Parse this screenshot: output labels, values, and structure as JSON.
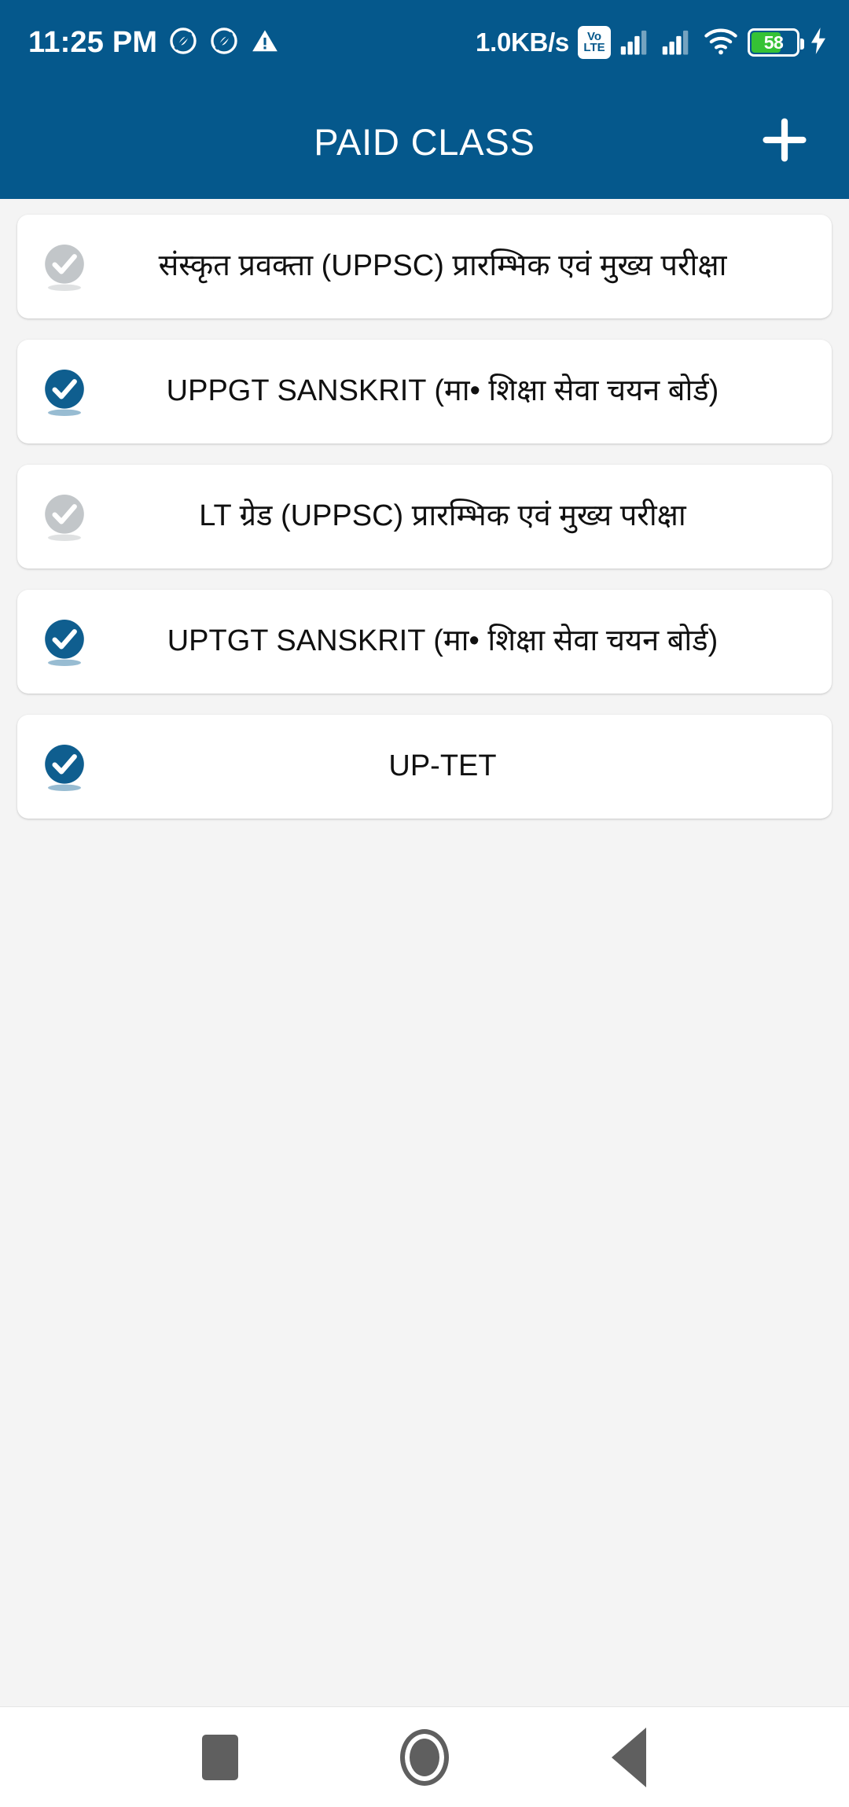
{
  "statusbar": {
    "clock": "11:25 PM",
    "network_speed": "1.0KB/s",
    "volte_top": "Vo",
    "volte_bottom": "LTE",
    "battery_percent": "58",
    "icons": [
      "dnd-icon",
      "dnd-icon",
      "warning-triangle-icon",
      "volte-icon",
      "signal-bars-icon",
      "signal-bars-icon",
      "wifi-icon",
      "battery-icon",
      "charging-bolt-icon"
    ]
  },
  "appbar": {
    "title": "PAID CLASS",
    "add_icon": "plus-icon"
  },
  "list": {
    "items": [
      {
        "label": "संस्कृत प्रवक्ता (UPPSC) प्रारम्भिक  एवं  मुख्य परीक्षा",
        "state": "inactive",
        "badge_icon": "check-circle-icon"
      },
      {
        "label": "UPPGT SANSKRIT (मा• शिक्षा सेवा चयन बोर्ड)",
        "state": "active",
        "badge_icon": "check-circle-icon"
      },
      {
        "label": "LT ग्रेड (UPPSC) प्रारम्भिक एवं मुख्य परीक्षा",
        "state": "inactive",
        "badge_icon": "check-circle-icon"
      },
      {
        "label": "UPTGT SANSKRIT (मा• शिक्षा सेवा चयन बोर्ड)",
        "state": "active",
        "badge_icon": "check-circle-icon"
      },
      {
        "label": "UP-TET",
        "state": "active",
        "badge_icon": "check-circle-icon"
      }
    ]
  },
  "navbar": {
    "buttons": [
      {
        "name": "recents-button",
        "icon": "square-icon"
      },
      {
        "name": "home-button",
        "icon": "circle-icon"
      },
      {
        "name": "back-button",
        "icon": "triangle-left-icon"
      }
    ]
  },
  "colors": {
    "primary": "#05588c",
    "badge_active": "#0f5e8f",
    "badge_inactive": "#c2c6c9",
    "background": "#f4f4f4",
    "card": "#ffffff",
    "battery_fill": "#35c235",
    "nav_icon": "#5f5f5f"
  }
}
